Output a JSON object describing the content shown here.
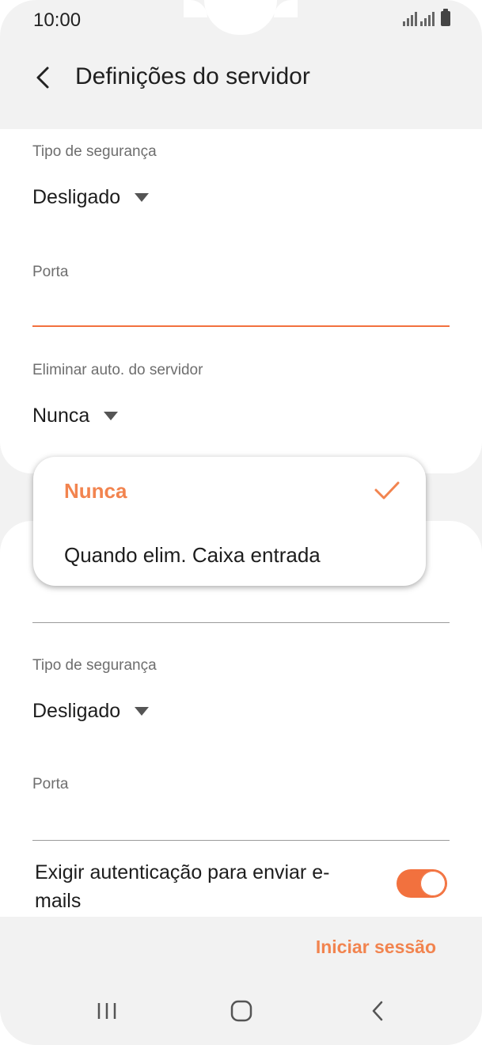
{
  "status_bar": {
    "time": "10:00"
  },
  "header": {
    "title": "Definições do servidor"
  },
  "incoming": {
    "security_label": "Tipo de segurança",
    "security_value": "Desligado",
    "port_label": "Porta",
    "auto_delete_label": "Eliminar auto. do servidor",
    "auto_delete_value": "Nunca"
  },
  "dropdown": {
    "options": [
      {
        "label": "Nunca",
        "selected": true
      },
      {
        "label": "Quando elim. Caixa entrada",
        "selected": false
      }
    ]
  },
  "outgoing": {
    "security_label": "Tipo de segurança",
    "security_value": "Desligado",
    "port_label": "Porta",
    "auth_label": "Exigir autenticação para enviar e-mails",
    "auth_enabled": true
  },
  "footer": {
    "login_label": "Iniciar sessão"
  },
  "colors": {
    "accent": "#f2713e",
    "accent_text": "#f2844f",
    "background": "#f2f2f2"
  },
  "nav": {
    "icons": [
      "recent-apps-icon",
      "home-icon",
      "back-icon"
    ]
  }
}
